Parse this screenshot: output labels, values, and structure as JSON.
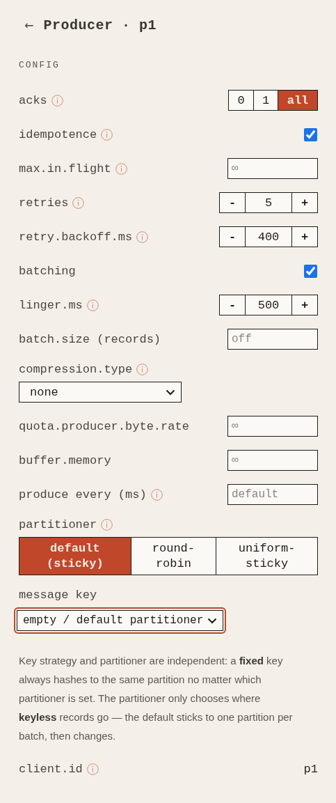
{
  "header": {
    "back": "←",
    "title": "Producer · p1"
  },
  "section": "CONFIG",
  "rows": [
    {
      "kind": "segmented",
      "label": "acks",
      "info": true,
      "options": [
        {
          "label": "0",
          "selected": false
        },
        {
          "label": "1",
          "selected": false
        },
        {
          "label": "all",
          "selected": true
        }
      ]
    },
    {
      "kind": "checkbox",
      "label": "idempotence",
      "info": true,
      "checked": true
    },
    {
      "kind": "input",
      "label": "max.in.flight",
      "info": true,
      "placeholder": "∞"
    },
    {
      "kind": "stepper",
      "label": "retries",
      "info": true,
      "minus": "-",
      "value": "5",
      "plus": "+"
    },
    {
      "kind": "stepper",
      "label": "retry.backoff.ms",
      "info": true,
      "minus": "-",
      "value": "400",
      "plus": "+"
    },
    {
      "kind": "checkbox",
      "label": "batching",
      "info": false,
      "checked": true
    },
    {
      "kind": "stepper",
      "label": "linger.ms",
      "info": true,
      "minus": "-",
      "value": "500",
      "plus": "+"
    },
    {
      "kind": "input",
      "label": "batch.size (records)",
      "info": false,
      "placeholder": "off"
    },
    {
      "kind": "select",
      "label": "compression.type",
      "info": true,
      "value": "none",
      "focused": false
    },
    {
      "kind": "input",
      "label": "quota.producer.byte.rate",
      "info": false,
      "placeholder": "∞"
    },
    {
      "kind": "input",
      "label": "buffer.memory",
      "info": false,
      "placeholder": "∞"
    },
    {
      "kind": "input",
      "label": "produce every (ms)",
      "info": true,
      "placeholder": "default"
    },
    {
      "kind": "choice",
      "label": "partitioner",
      "info": true,
      "options": [
        {
          "label": "default (sticky)",
          "selected": true
        },
        {
          "label": "round-robin",
          "selected": false
        },
        {
          "label": "uniform-sticky",
          "selected": false
        }
      ]
    },
    {
      "kind": "select",
      "label": "message key",
      "info": false,
      "value": "empty / default partitioner",
      "focused": true
    },
    {
      "kind": "note",
      "text": "Key strategy and partitioner are independent: a **fixed** key always hashes to the same partition no matter which partitioner is set. The partitioner only chooses where **keyless** records go — the default sticks to one partition per batch, then changes."
    },
    {
      "kind": "readout",
      "label": "client.id",
      "info": true,
      "value": "p1"
    }
  ]
}
